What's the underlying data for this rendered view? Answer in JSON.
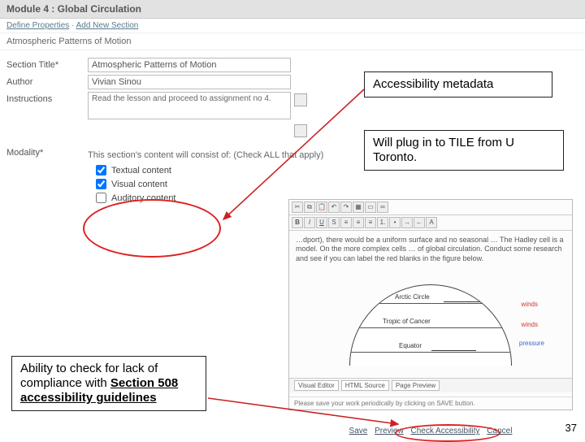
{
  "module": {
    "title": "Module 4 : Global Circulation"
  },
  "crumb": {
    "define": "Define Properties",
    "sep": " · ",
    "add": "Add New Section"
  },
  "section_name": "Atmospheric Patterns of Motion",
  "form": {
    "section_title_lbl": "Section Title*",
    "section_title_val": "Atmospheric Patterns of Motion",
    "author_lbl": "Author",
    "author_val": "Vivian Sinou",
    "instructions_lbl": "Instructions",
    "instructions_val": "Read the lesson and proceed to assignment no 4.",
    "modality_lbl": "Modality*",
    "modality_lead": "This section's content will consist of: (Check ALL that apply)",
    "opt_textual": "Textual content",
    "opt_visual": "Visual content",
    "opt_auditory": "Auditory content"
  },
  "editor": {
    "body": "…dport), there would be a uniform surface and no seasonal … The Hadley cell is a model. On the more complex cells … of global circulation.  Conduct some research and see if you can label the red blanks in the figure below.",
    "arctic": "Arctic Circle",
    "tropic": "Tropic of Cancer",
    "equator": "Equator",
    "winds": "winds",
    "pressure": "pressure",
    "tab_visual": "Visual Editor",
    "tab_html": "HTML Source",
    "tab_preview": "Page Preview",
    "foot": "Please save your work periodically by clicking on SAVE button."
  },
  "actions": {
    "save": "Save",
    "preview": "Preview",
    "check": "Check Accessibility",
    "cancel": "Cancel"
  },
  "callouts": {
    "c1": "Accessibility metadata",
    "c2": "Will plug in to TILE from U Toronto.",
    "c3a": "Ability to check for lack of compliance with ",
    "c3b": "Section 508 accessibility guidelines"
  },
  "page": "37"
}
